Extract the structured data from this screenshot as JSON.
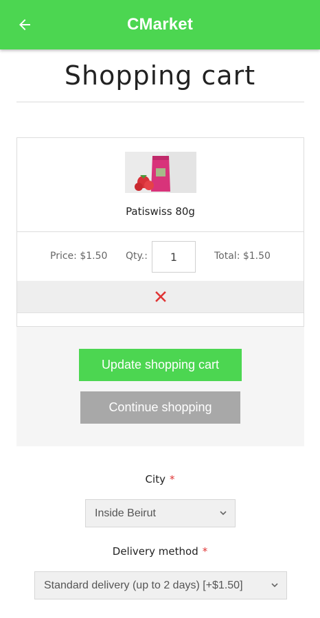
{
  "appbar": {
    "title": "CMarket",
    "back_icon": "arrow-left-icon",
    "color": "#4cd651"
  },
  "page": {
    "title": "Shopping cart"
  },
  "cart": {
    "items": [
      {
        "name": "Patiswiss 80g",
        "image_icon": "product-photo",
        "price_text": "Price: $1.50",
        "qty_label": "Qty.:",
        "qty_value": "1",
        "total_text": "Total: $1.50",
        "remove_icon": "close-icon"
      }
    ]
  },
  "actions": {
    "update_label": "Update shopping cart",
    "continue_label": "Continue shopping",
    "update_color": "#4cd651",
    "continue_color": "#a8a8a8"
  },
  "form": {
    "city": {
      "label": "City",
      "required_mark": "*",
      "selected": "Inside Beirut"
    },
    "delivery": {
      "label": "Delivery method",
      "required_mark": "*",
      "selected": "Standard delivery (up to 2 days) [+$1.50]"
    }
  }
}
